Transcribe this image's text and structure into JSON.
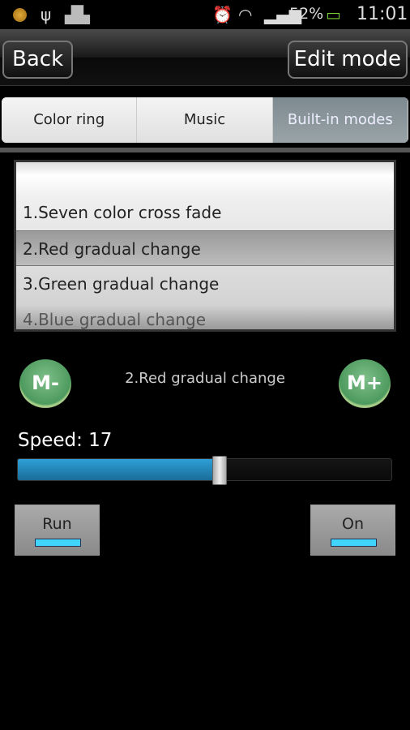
{
  "status_bar": {
    "battery": "52%",
    "time": "11:01",
    "icons": [
      "notification-coin-icon",
      "usb-icon",
      "android-icon",
      "alarm-icon",
      "wifi-icon",
      "signal-icon",
      "battery-charging-icon"
    ]
  },
  "header": {
    "back_label": "Back",
    "edit_label": "Edit mode"
  },
  "tabs": [
    {
      "label": "Color ring"
    },
    {
      "label": "Music"
    },
    {
      "label": "Built-in modes",
      "active": true
    }
  ],
  "modes": [
    {
      "label": "1.Seven color cross fade"
    },
    {
      "label": "2.Red gradual change",
      "selected": true
    },
    {
      "label": "3.Green gradual change"
    },
    {
      "label": "4.Blue gradual change"
    }
  ],
  "controls": {
    "minus_label": "M-",
    "plus_label": "M+",
    "current_mode": "2.Red gradual change"
  },
  "speed": {
    "label": "Speed: 17",
    "fraction": 0.54
  },
  "toggles": {
    "run_label": "Run",
    "on_label": "On",
    "indicator_color": "#41d4ff"
  },
  "colors": {
    "slider": "#2ea0d8",
    "active_tab": "#8a969b",
    "mode_button": "#4d9a5e"
  }
}
